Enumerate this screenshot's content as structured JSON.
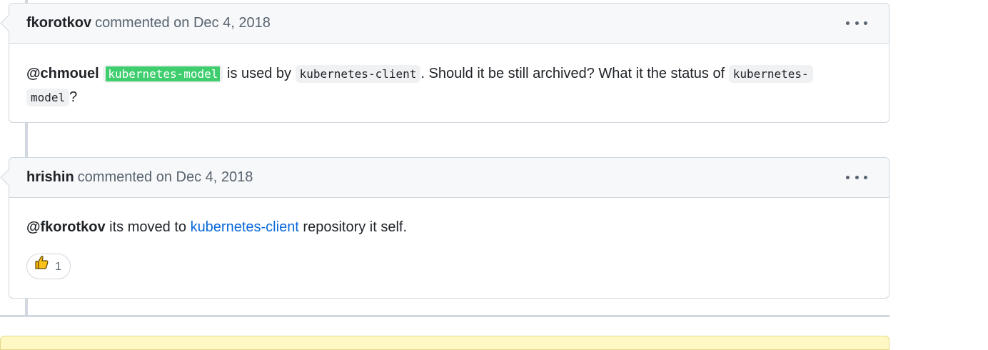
{
  "comments": [
    {
      "author": "fkorotkov",
      "meta": "commented on Dec 4, 2018",
      "body": {
        "mention": "@chmouel",
        "code1": "kubernetes-model",
        "text1": " is used by ",
        "code2": "kubernetes-client",
        "text2": ". Should it be still archived? What it the status of ",
        "code3a": "kubernetes-",
        "code3b": "model",
        "text3": "?"
      }
    },
    {
      "author": "hrishin",
      "meta": "commented on Dec 4, 2018",
      "body": {
        "mention": "@fkorotkov",
        "text1": " its moved to ",
        "link": "kubernetes-client",
        "text2": " repository it self."
      },
      "reaction": {
        "icon": "thumbs-up-icon",
        "count": "1"
      }
    }
  ],
  "colors": {
    "link": "#0969da",
    "highlight": "#3fce6e",
    "header_bg": "#f6f8fa",
    "border": "#d0d7de",
    "banner": "#fff8c5"
  }
}
